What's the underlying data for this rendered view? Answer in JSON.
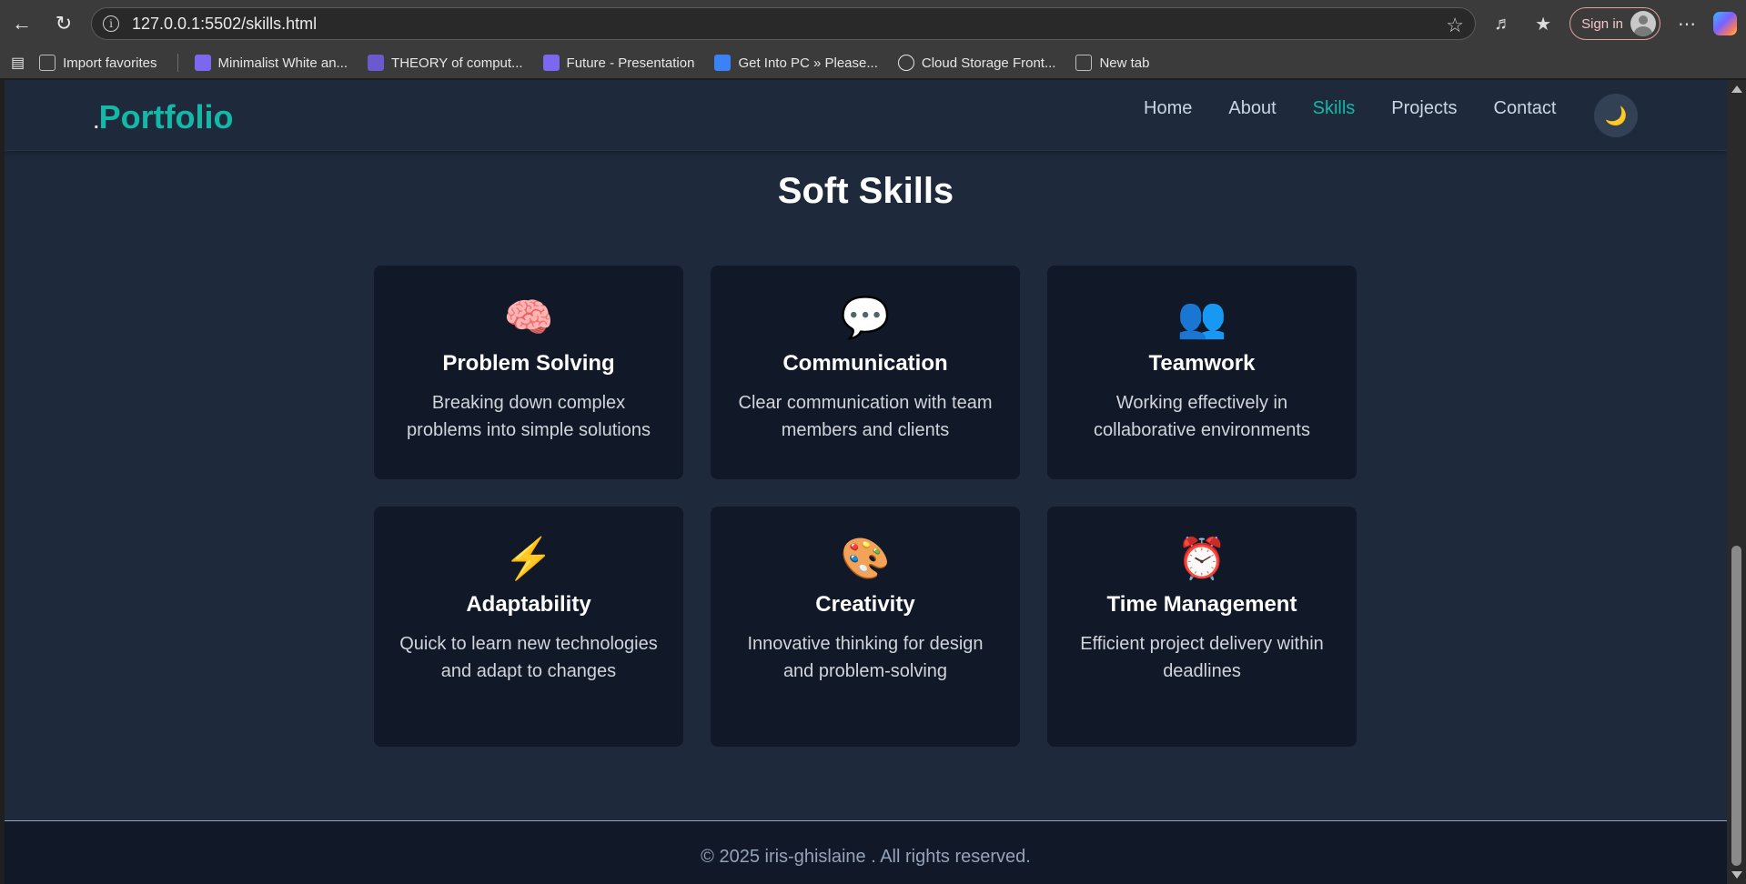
{
  "browser": {
    "url": "127.0.0.1:5502/skills.html",
    "signin_label": "Sign in",
    "bookmarks": [
      {
        "label": "Import favorites",
        "color": "#9aa0a6"
      },
      {
        "label": "Minimalist White an...",
        "color": "#7b68ee"
      },
      {
        "label": "THEORY of comput...",
        "color": "#6a5acd"
      },
      {
        "label": "Future - Presentation",
        "color": "#7b68ee"
      },
      {
        "label": "Get Into PC » Please...",
        "color": "#3b82f6"
      },
      {
        "label": "Cloud Storage Front...",
        "color": "#e5e7eb"
      },
      {
        "label": "New tab",
        "color": "#9aa0a6"
      }
    ]
  },
  "site": {
    "logo_dot": ".",
    "logo_text": "Portfolio",
    "nav": [
      {
        "label": "Home",
        "active": false
      },
      {
        "label": "About",
        "active": false
      },
      {
        "label": "Skills",
        "active": true
      },
      {
        "label": "Projects",
        "active": false
      },
      {
        "label": "Contact",
        "active": false
      }
    ],
    "theme_icon": "🌙",
    "accent_color": "#14b8a6"
  },
  "section": {
    "title": "Soft Skills",
    "cards": [
      {
        "icon": "🧠",
        "icon_name": "brain-icon",
        "title": "Problem Solving",
        "desc": "Breaking down complex problems into simple solutions"
      },
      {
        "icon": "💬",
        "icon_name": "speech-bubble-icon",
        "title": "Communication",
        "desc": "Clear communication with team members and clients"
      },
      {
        "icon": "👥",
        "icon_name": "people-icon",
        "title": "Teamwork",
        "desc": "Working effectively in collaborative environments"
      },
      {
        "icon": "⚡",
        "icon_name": "lightning-icon",
        "title": "Adaptability",
        "desc": "Quick to learn new technologies and adapt to changes"
      },
      {
        "icon": "🎨",
        "icon_name": "palette-icon",
        "title": "Creativity",
        "desc": "Innovative thinking for design and problem-solving"
      },
      {
        "icon": "⏰",
        "icon_name": "alarm-clock-icon",
        "title": "Time Management",
        "desc": "Efficient project delivery within deadlines"
      }
    ]
  },
  "footer": {
    "text": "© 2025 iris-ghislaine . All rights reserved."
  }
}
